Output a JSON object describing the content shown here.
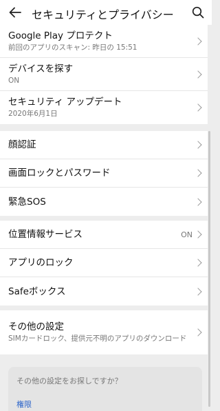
{
  "header": {
    "title": "セキュリティとプライバシー"
  },
  "groups": [
    {
      "items": [
        {
          "title": "Google Play プロテクト",
          "subtitle": "前回のアプリのスキャン: 昨日の 15:51"
        },
        {
          "title": "デバイスを探す",
          "subtitle": "ON"
        },
        {
          "title": "セキュリティ アップデート",
          "subtitle": "2020年6月1日"
        }
      ]
    },
    {
      "items": [
        {
          "title": "顔認証"
        },
        {
          "title": "画面ロックとパスワード"
        },
        {
          "title": "緊急SOS"
        }
      ]
    },
    {
      "items": [
        {
          "title": "位置情報サービス",
          "value": "ON"
        },
        {
          "title": "アプリのロック"
        },
        {
          "title": "Safeボックス"
        }
      ]
    },
    {
      "items": [
        {
          "title": "その他の設定",
          "subtitle": "SIMカードロック、提供元不明のアプリのダウンロード"
        }
      ]
    }
  ],
  "suggestions": {
    "title": "その他の設定をお探しですか？",
    "link": "権限"
  }
}
